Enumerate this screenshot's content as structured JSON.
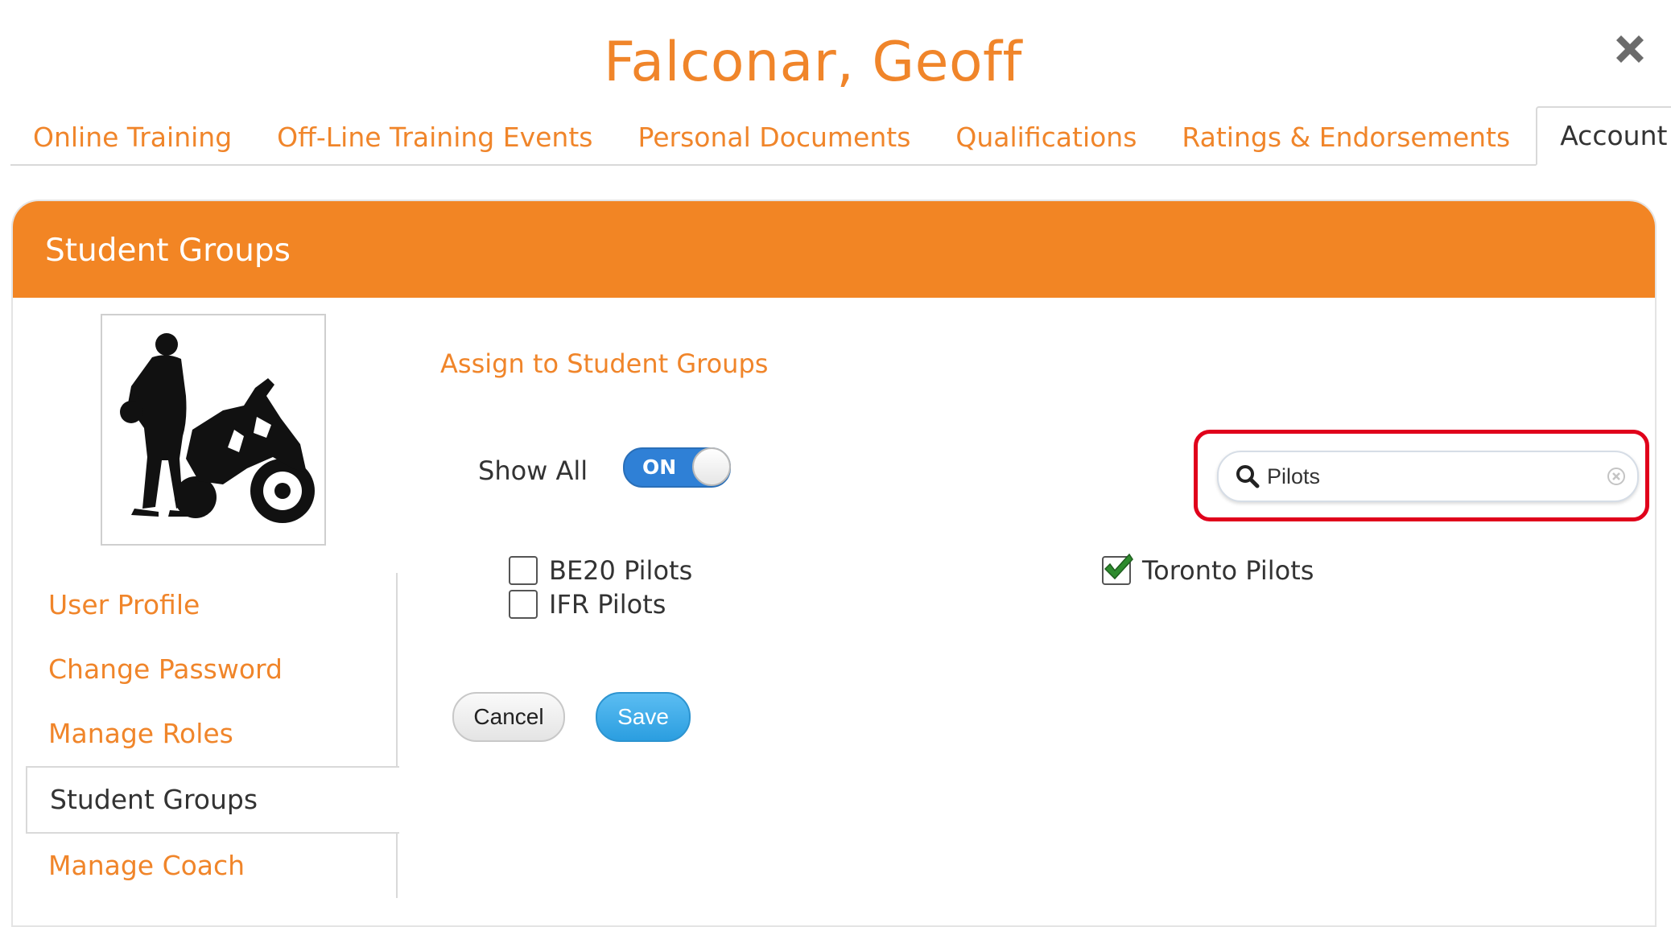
{
  "page": {
    "title": "Falconar, Geoff"
  },
  "icons": {
    "close": "close-icon",
    "search": "search-icon",
    "clear": "clear-icon",
    "check": "checkmark-icon"
  },
  "colors": {
    "accent": "#f28524",
    "toggle": "#2f80d6",
    "save": "#2b9ee0",
    "highlight": "#e0001b",
    "check": "#2e8b2e"
  },
  "tabs": [
    {
      "label": "Online Training",
      "active": false
    },
    {
      "label": "Off-Line Training Events",
      "active": false
    },
    {
      "label": "Personal Documents",
      "active": false
    },
    {
      "label": "Qualifications",
      "active": false
    },
    {
      "label": "Ratings & Endorsements",
      "active": false
    },
    {
      "label": "Account",
      "active": true
    }
  ],
  "panel": {
    "title": "Student Groups"
  },
  "sidebar": {
    "items": [
      {
        "label": "User Profile",
        "active": false
      },
      {
        "label": "Change Password",
        "active": false
      },
      {
        "label": "Manage Roles",
        "active": false
      },
      {
        "label": "Student Groups",
        "active": true
      },
      {
        "label": "Manage Coach",
        "active": false
      }
    ]
  },
  "main": {
    "assign_label": "Assign to Student Groups",
    "show_all": {
      "label": "Show All",
      "state": "ON"
    },
    "search": {
      "value": "Pilots",
      "placeholder": ""
    },
    "groups": [
      {
        "label": "BE20 Pilots",
        "checked": false
      },
      {
        "label": "IFR Pilots",
        "checked": false
      },
      {
        "label": "Toronto Pilots",
        "checked": true
      }
    ],
    "buttons": {
      "cancel": "Cancel",
      "save": "Save"
    }
  }
}
